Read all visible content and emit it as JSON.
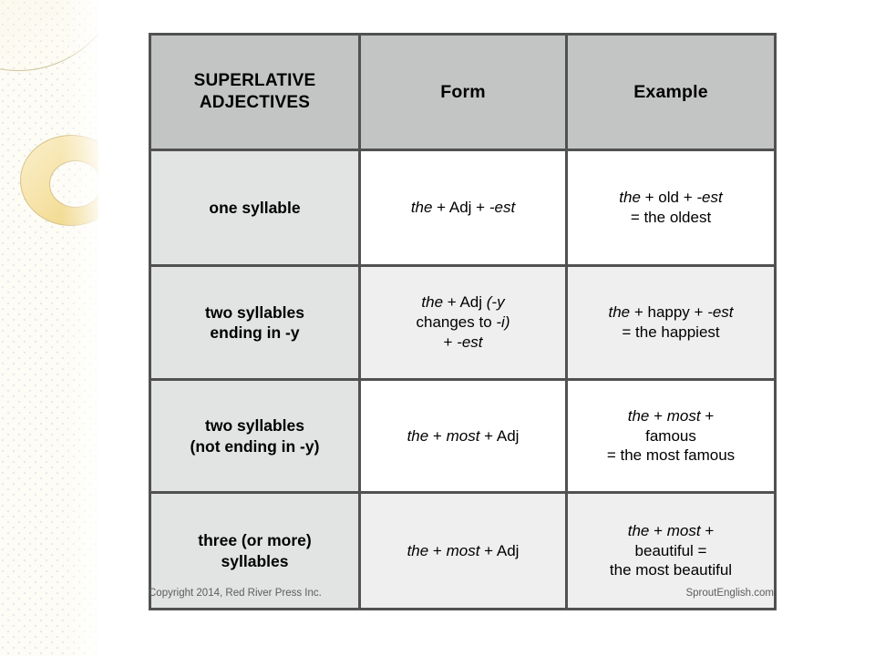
{
  "page": {
    "background_color": "#ffffff",
    "accent_color": "#eccf73",
    "border_color": "#515151",
    "header_fill": "#c3c4c4",
    "rowlabel_fill": "#e2e3e3"
  },
  "table": {
    "headers": {
      "col1": "SUPERLATIVE ADJECTIVES",
      "col1_line1": "SUPERLATIVE",
      "col1_line2": "ADJECTIVES",
      "col2": "Form",
      "col3": "Example"
    },
    "rows": [
      {
        "label": "one syllable",
        "label_lines": [
          "one syllable"
        ],
        "form": {
          "parts": [
            {
              "text": "the",
              "italic": true
            },
            {
              "text": " + Adj + ",
              "italic": false
            },
            {
              "text": "-est",
              "italic": true
            }
          ],
          "plain": "the + Adj + -est"
        },
        "example": {
          "line1_parts": [
            {
              "text": "the",
              "italic": true
            },
            {
              "text": " + old + ",
              "italic": false
            },
            {
              "text": "-est",
              "italic": true
            }
          ],
          "line2": "= the oldest",
          "plain": "the + old + -est = the oldest"
        },
        "form_fill": "#ffffff",
        "example_fill": "#ffffff"
      },
      {
        "label": "two syllables ending in -y",
        "label_lines": [
          "two syllables",
          "ending in -y"
        ],
        "form": {
          "parts": [
            {
              "text": "the",
              "italic": true
            },
            {
              "text": " + Adj ",
              "italic": false
            },
            {
              "text": "(-y",
              "italic": true
            },
            {
              "text": " changes to ",
              "italic": false
            },
            {
              "text": "-i)",
              "italic": true
            },
            {
              "text": " + ",
              "italic": false
            },
            {
              "text": "-est",
              "italic": true
            }
          ],
          "plain": "the + Adj (-y changes to -i) + -est"
        },
        "example": {
          "line1_parts": [
            {
              "text": "the",
              "italic": true
            },
            {
              "text": " + happy + ",
              "italic": false
            },
            {
              "text": "-est",
              "italic": true
            }
          ],
          "line2": "= the happiest",
          "plain": "the + happy + -est = the happiest"
        },
        "form_fill": "#efefef",
        "example_fill": "#efefef"
      },
      {
        "label": "two syllables (not ending in -y)",
        "label_lines": [
          "two syllables",
          "(not ending in -y)"
        ],
        "form": {
          "parts": [
            {
              "text": "the",
              "italic": true
            },
            {
              "text": " + ",
              "italic": false
            },
            {
              "text": "most",
              "italic": true
            },
            {
              "text": " + Adj",
              "italic": false
            }
          ],
          "plain": "the + most + Adj"
        },
        "example": {
          "line1_parts": [
            {
              "text": "the",
              "italic": true
            },
            {
              "text": " + ",
              "italic": false
            },
            {
              "text": "most",
              "italic": true
            },
            {
              "text": " +",
              "italic": false
            }
          ],
          "line2": "famous",
          "line3": "= the most famous",
          "plain": "the + most + famous = the most famous"
        },
        "form_fill": "#ffffff",
        "example_fill": "#ffffff"
      },
      {
        "label": "three (or more) syllables",
        "label_lines": [
          "three (or more)",
          "syllables"
        ],
        "form": {
          "parts": [
            {
              "text": "the",
              "italic": true
            },
            {
              "text": " + ",
              "italic": false
            },
            {
              "text": "most",
              "italic": true
            },
            {
              "text": " + Adj",
              "italic": false
            }
          ],
          "plain": "the + most + Adj"
        },
        "example": {
          "line1_parts": [
            {
              "text": "the",
              "italic": true
            },
            {
              "text": " + ",
              "italic": false
            },
            {
              "text": "most",
              "italic": true
            },
            {
              "text": " +",
              "italic": false
            }
          ],
          "line2": "beautiful =",
          "line3": "the most beautiful",
          "plain": "the + most + beautiful = the most beautiful"
        },
        "form_fill": "#efefef",
        "example_fill": "#efefef"
      }
    ]
  },
  "footer": {
    "copyright": "Copyright 2014, Red River Press Inc.",
    "website": "SproutEnglish.com"
  },
  "decoration": {
    "ring_label": "gold-ring-shape",
    "arc_label": "gold-arc-shape",
    "panel_label": "textured-side-panel"
  }
}
